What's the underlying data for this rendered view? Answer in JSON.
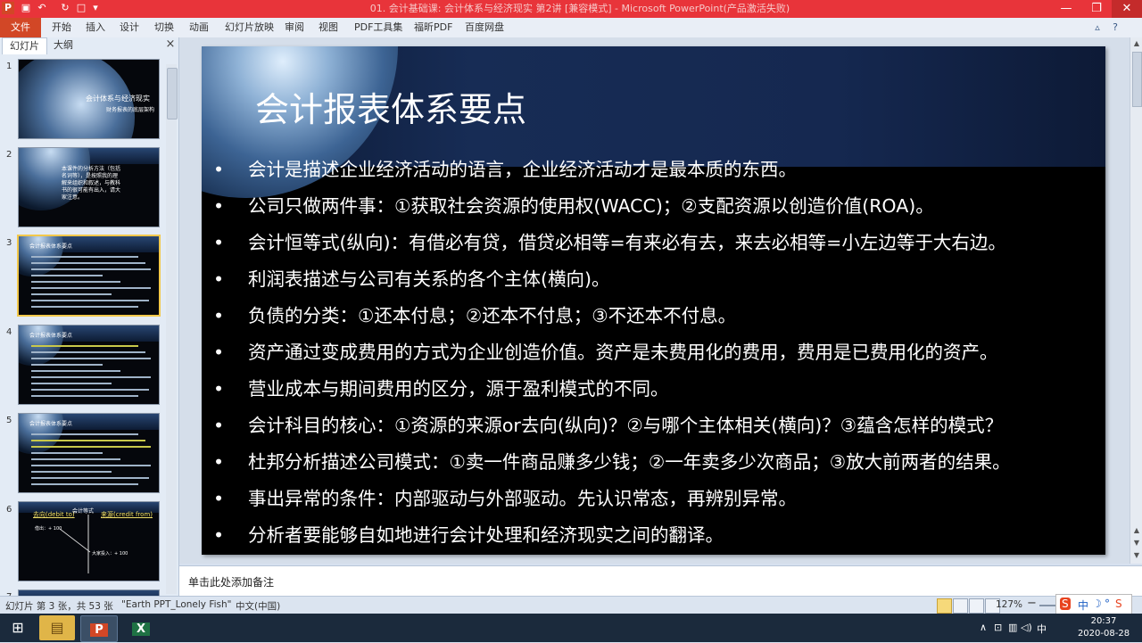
{
  "window": {
    "title": "01. 会计基础课: 会计体系与经济现实 第2讲 [兼容模式] - Microsoft PowerPoint(产品激活失败)",
    "app_icon": "P",
    "controls": [
      "minimize-icon",
      "restore-icon",
      "close-icon"
    ]
  },
  "ribbon": {
    "file_label": "文件",
    "tabs": [
      "开始",
      "插入",
      "设计",
      "切换",
      "动画",
      "幻灯片放映",
      "审阅",
      "视图",
      "PDF工具集",
      "福昕PDF",
      "百度网盘"
    ]
  },
  "left_pane": {
    "tabs": [
      "幻灯片",
      "大纲"
    ],
    "close": "×",
    "slides": [
      {
        "num": "1",
        "title": "会计体系与经济现实",
        "subtitle": "财务报表的底层架构"
      },
      {
        "num": "2",
        "text": "本课件的分析方法（包括名词等），是按照我的理解来组织和叙述，与教科书的很可能有出入，请大家注意。"
      },
      {
        "num": "3",
        "title": "会计报表体系要点"
      },
      {
        "num": "4",
        "title": "会计报表体系要点"
      },
      {
        "num": "5",
        "title": "会计报表体系要点"
      },
      {
        "num": "6",
        "left": "去向(debit to)",
        "center": "会计等式",
        "right": "来源(credit from)",
        "a": "借出：+ 100",
        "b": "大家投入：+ 100"
      },
      {
        "num": "7"
      }
    ]
  },
  "slide": {
    "title": "会计报表体系要点",
    "bullet_char": "•",
    "bullets": [
      "会计是描述企业经济活动的语言，企业经济活动才是最本质的东西。",
      "公司只做两件事：①获取社会资源的使用权(WACC)；②支配资源以创造价值(ROA)。",
      "会计恒等式(纵向)：有借必有贷，借贷必相等=有来必有去，来去必相等=小左边等于大右边。",
      "利润表描述与公司有关系的各个主体(横向)。",
      "负债的分类：①还本付息；②还本不付息；③不还本不付息。",
      "资产通过变成费用的方式为企业创造价值。资产是未费用化的费用，费用是已费用化的资产。",
      "营业成本与期间费用的区分，源于盈利模式的不同。",
      "会计科目的核心：①资源的来源or去向(纵向)？②与哪个主体相关(横向)？③蕴含怎样的模式？",
      "杜邦分析描述公司模式：①卖一件商品赚多少钱；②一年卖多少次商品；③放大前两者的结果。",
      "事出异常的条件：内部驱动与外部驱动。先认识常态，再辨别异常。",
      "分析者要能够自如地进行会计处理和经济现实之间的翻译。"
    ]
  },
  "notes": {
    "placeholder": "单击此处添加备注"
  },
  "status": {
    "slide_info": "幻灯片 第 3 张，共 53 张",
    "theme": "\"Earth PPT_Lonely Fish\"",
    "language": "中文(中国)",
    "zoom": "127%",
    "zoom_minus": "−",
    "zoom_plus": "+"
  },
  "ime": {
    "items": [
      "S",
      "中",
      "☽",
      "°",
      "S"
    ]
  },
  "taskbar": {
    "time": "20:37",
    "date": "2020-08-28",
    "tray": [
      "∧",
      "⊡",
      "▥",
      "◁)",
      "中"
    ]
  },
  "colors": {
    "titlebar": "#e8343a",
    "file_tab": "#d24726",
    "selected_thumb": "#f2c84b"
  }
}
